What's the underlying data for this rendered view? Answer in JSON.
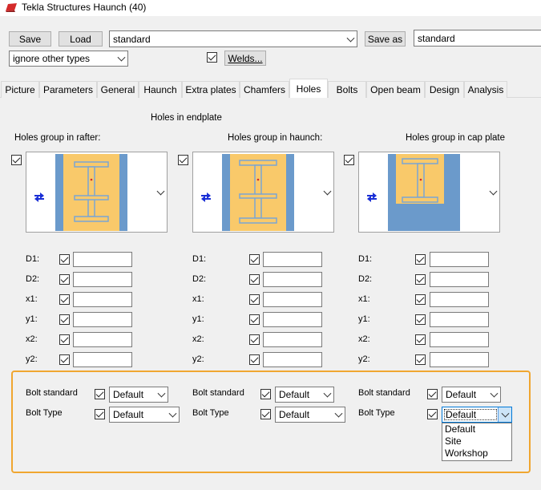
{
  "window": {
    "title": "Tekla Structures  Haunch (40)"
  },
  "toolbar": {
    "save_label": "Save",
    "load_label": "Load",
    "preset_value": "standard",
    "save_as_label": "Save as",
    "save_as_value": "standard",
    "filter_value": "ignore other types",
    "welds_label": "Welds..."
  },
  "tabs": [
    "Picture",
    "Parameters",
    "General",
    "Haunch",
    "Extra plates",
    "Chamfers",
    "Holes",
    "Bolts",
    "Open beam",
    "Design",
    "Analysis"
  ],
  "active_tab": "Holes",
  "section_title": "Holes in endplate",
  "groups": [
    {
      "title": "Holes group in rafter:"
    },
    {
      "title": "Holes group in haunch:"
    },
    {
      "title": "Holes group in cap plate"
    }
  ],
  "dim_labels": [
    "D1:",
    "D2:",
    "x1:",
    "y1:",
    "x2:",
    "y2:"
  ],
  "bolt": {
    "standard_label": "Bolt standard",
    "type_label": "Bolt Type",
    "standard_value": "Default",
    "type_value": "Default"
  },
  "dropdown_options": [
    "Default",
    "Site",
    "Workshop"
  ],
  "colors": {
    "beam_fill": "#f9c96a",
    "web_blue": "#6b9acb",
    "highlight": "#f0a630"
  }
}
